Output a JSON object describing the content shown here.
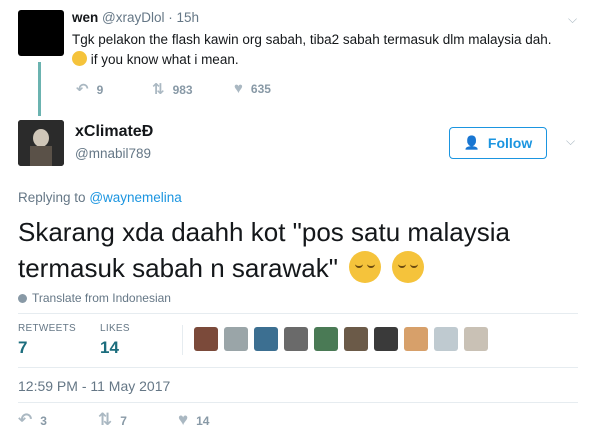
{
  "parent_tweet": {
    "name": "wen",
    "handle": "@xrayDlol",
    "separator": "·",
    "time": "15h",
    "text_line1": "Tgk pelakon the flash kawin org sabah, tiba2 sabah termasuk dlm malaysia dah.",
    "text_line2": "if you know what i mean.",
    "replies": "9",
    "retweets": "983",
    "likes": "635"
  },
  "main_tweet": {
    "name": "xClimateÐ",
    "handle": "@mnabil789",
    "follow_label": "Follow",
    "reply_prefix": "Replying to",
    "reply_to": "@waynemelina",
    "text_line1": "Skarang xda daahh kot \"pos satu malaysia",
    "text_line2": "termasuk sabah n sarawak\"",
    "translate_label": "Translate from Indonesian",
    "retweets_label": "RETWEETS",
    "retweets_count": "7",
    "likes_label": "LIKES",
    "likes_count": "14",
    "timestamp": "12:59 PM - 11 May 2017",
    "reply_count": "3",
    "retweet_count_bottom": "7",
    "like_count_bottom": "14"
  },
  "icons": {
    "reply": "reply-icon",
    "retweet": "retweet-icon",
    "like": "heart-icon",
    "caret": "chevron-down-icon",
    "follow": "add-person-icon",
    "globe": "globe-icon"
  },
  "colors": {
    "accent": "#1b95e0",
    "thread_line": "#6bb3b0",
    "stat_value": "#1b6d7d",
    "muted": "#657786"
  },
  "liker_avatar_colors": [
    "#7b4a3a",
    "#9aa5a8",
    "#3c6f91",
    "#6a6a6a",
    "#4a7a55",
    "#6b5a48",
    "#3a3a3a",
    "#d7a06a",
    "#bfcad0",
    "#c9c1b5"
  ]
}
